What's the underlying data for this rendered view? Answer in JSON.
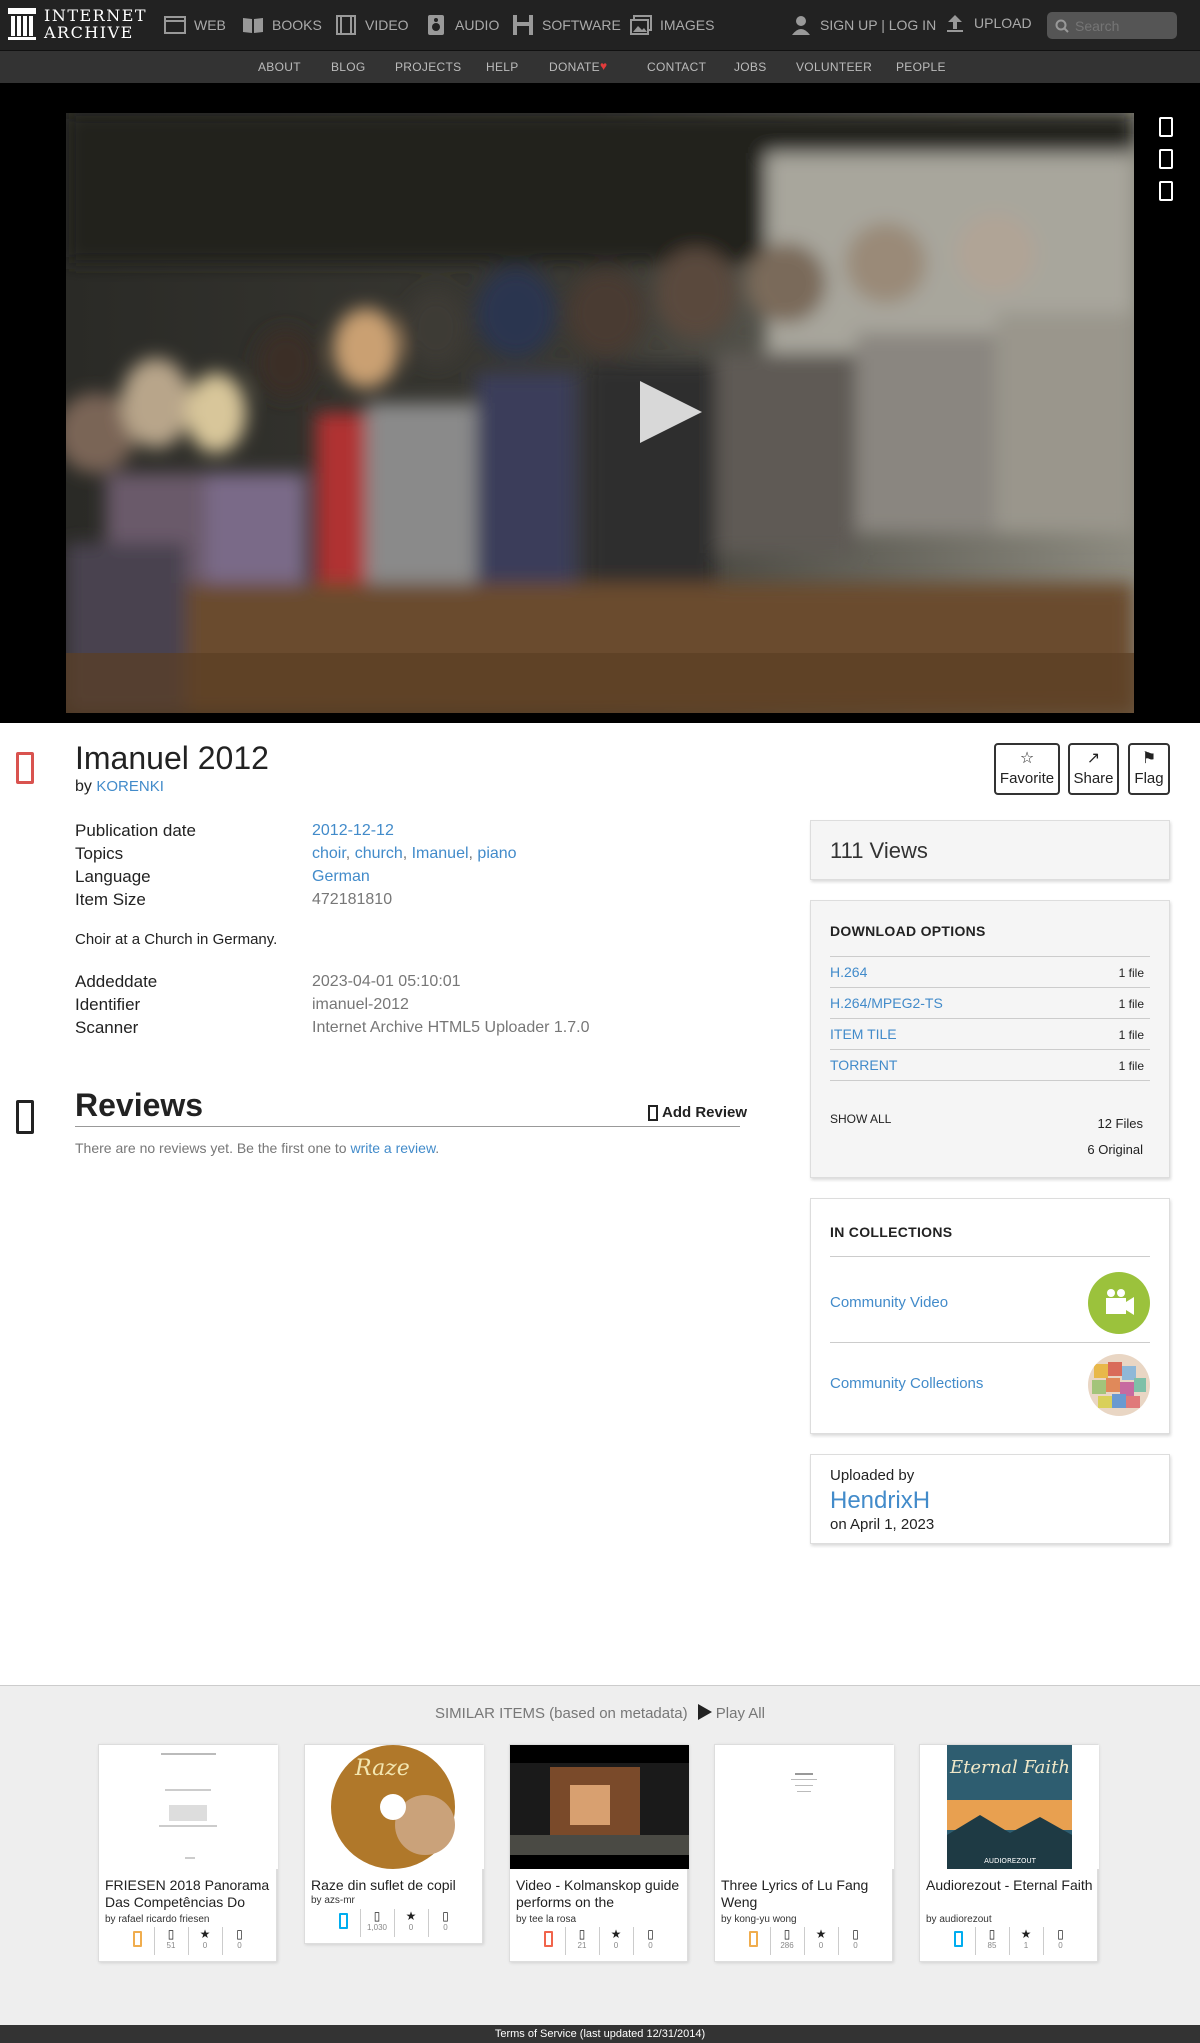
{
  "topnav": {
    "logo_line1": "INTERNET",
    "logo_line2": "ARCHIVE",
    "items": [
      {
        "label": "WEB",
        "icon": "web-icon"
      },
      {
        "label": "BOOKS",
        "icon": "books-icon"
      },
      {
        "label": "VIDEO",
        "icon": "video-icon"
      },
      {
        "label": "AUDIO",
        "icon": "audio-icon"
      },
      {
        "label": "SOFTWARE",
        "icon": "software-icon"
      },
      {
        "label": "IMAGES",
        "icon": "images-icon"
      }
    ],
    "signin": "SIGN UP | LOG IN",
    "upload": "UPLOAD",
    "search_placeholder": "Search"
  },
  "subnav": [
    "ABOUT",
    "BLOG",
    "PROJECTS",
    "HELP",
    "DONATE",
    "CONTACT",
    "JOBS",
    "VOLUNTEER",
    "PEOPLE"
  ],
  "item": {
    "title": "Imanuel 2012",
    "by_prefix": "by",
    "creator": "KORENKI",
    "actions": {
      "favorite": "Favorite",
      "share": "Share",
      "flag": "Flag"
    },
    "meta": [
      {
        "key": "Publication date",
        "value": "2012-12-12",
        "link": true
      },
      {
        "key": "Topics",
        "value": "",
        "links": [
          "choir",
          "church",
          "Imanuel",
          "piano"
        ]
      },
      {
        "key": "Language",
        "value": "German",
        "link": true
      },
      {
        "key": "Item Size",
        "value": "472181810",
        "link": false
      }
    ],
    "description": "Choir at a Church in Germany.",
    "meta2": [
      {
        "key": "Addeddate",
        "value": "2023-04-01 05:10:01"
      },
      {
        "key": "Identifier",
        "value": "imanuel-2012"
      },
      {
        "key": "Scanner",
        "value": "Internet Archive HTML5 Uploader 1.7.0"
      }
    ]
  },
  "reviews": {
    "title": "Reviews",
    "add": "Add Review",
    "empty_prefix": "There are no reviews yet. Be the first one to ",
    "empty_link": "write a review",
    "empty_suffix": "."
  },
  "sidebar": {
    "views": "111 Views",
    "download_title": "DOWNLOAD OPTIONS",
    "downloads": [
      {
        "format": "H.264",
        "count": "1 file"
      },
      {
        "format": "H.264/MPEG2-TS",
        "count": "1 file"
      },
      {
        "format": "ITEM TILE",
        "count": "1 file"
      },
      {
        "format": "TORRENT",
        "count": "1 file"
      }
    ],
    "show_all": "SHOW ALL",
    "files": "12 Files",
    "original": "6 Original",
    "collections_title": "IN COLLECTIONS",
    "collections": [
      "Community Video",
      "Community Collections"
    ],
    "uploaded_by_label": "Uploaded by",
    "uploader": "HendrixH",
    "uploaded_on": "on April 1, 2023"
  },
  "similar": {
    "heading": "SIMILAR ITEMS (based on metadata)",
    "play_all": "Play All",
    "items": [
      {
        "title": "FRIESEN 2018 Panorama Das Competências Do",
        "by": "by rafael ricardo friesen",
        "views": "51",
        "favs": "0",
        "reviews": "0",
        "type_color": "#f0ad4e"
      },
      {
        "title": "Raze din suflet de copil",
        "by": "by azs-mr",
        "views": "1,030",
        "favs": "0",
        "reviews": "0",
        "type_color": "#00adef"
      },
      {
        "title": "Video - Kolmanskop guide performs on the",
        "by": "by tee la rosa",
        "views": "21",
        "favs": "0",
        "reviews": "0",
        "type_color": "#f1644b"
      },
      {
        "title": "Three Lyrics of Lu Fang Weng",
        "by": "by kong-yu wong",
        "views": "286",
        "favs": "0",
        "reviews": "0",
        "type_color": "#f0ad4e"
      },
      {
        "title": "Audiorezout - Eternal Faith",
        "by": "by audiorezout",
        "views": "85",
        "favs": "1",
        "reviews": "0",
        "type_color": "#00adef"
      }
    ],
    "thumb2_text": "Raze",
    "thumb5_text": "Eternal Faith",
    "thumb5_sub": "AUDIOREZOUT"
  },
  "footer": "Terms of Service (last updated 12/31/2014)"
}
